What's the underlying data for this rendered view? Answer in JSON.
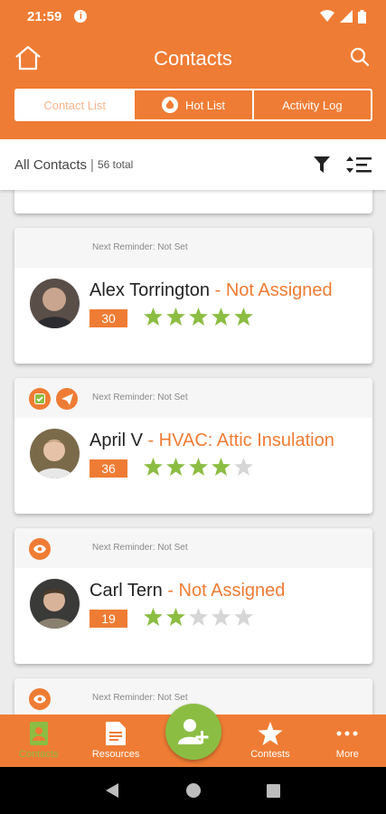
{
  "status_bar": {
    "time": "21:59",
    "info_glyph": "i"
  },
  "header": {
    "title": "Contacts"
  },
  "tabs": [
    {
      "label": "Contact List",
      "active": true
    },
    {
      "label": "Hot List",
      "active": false
    },
    {
      "label": "Activity Log",
      "active": false
    }
  ],
  "filter_bar": {
    "label": "All Contacts",
    "separator": "|",
    "total": "56 total"
  },
  "contacts": [
    {
      "reminder": "Next Reminder: Not Set",
      "name": "Alex Torrington",
      "assignment": "- Not Assigned",
      "score": "30",
      "rating": 5,
      "badges": []
    },
    {
      "reminder": "Next Reminder: Not Set",
      "name": "April V",
      "assignment": "- HVAC: Attic Insulation",
      "score": "36",
      "rating": 4,
      "badges": [
        "check-icon",
        "send-icon"
      ]
    },
    {
      "reminder": "Next Reminder: Not Set",
      "name": "Carl Tern",
      "assignment": "- Not Assigned",
      "score": "19",
      "rating": 2,
      "badges": [
        "eye-icon"
      ]
    },
    {
      "reminder": "Next Reminder: Not Set",
      "badges": [
        "eye-icon"
      ]
    }
  ],
  "bottom_nav": [
    {
      "label": "Contacts",
      "icon": "contacts-icon",
      "active": true
    },
    {
      "label": "Resources",
      "icon": "document-icon",
      "active": false
    },
    {
      "label": "Contests",
      "icon": "star-icon",
      "active": false
    },
    {
      "label": "More",
      "icon": "more-dots-icon",
      "active": false
    }
  ],
  "colors": {
    "brand": "#ef7c34",
    "accent": "#8cbd43",
    "star_empty": "#d6d6d6"
  }
}
